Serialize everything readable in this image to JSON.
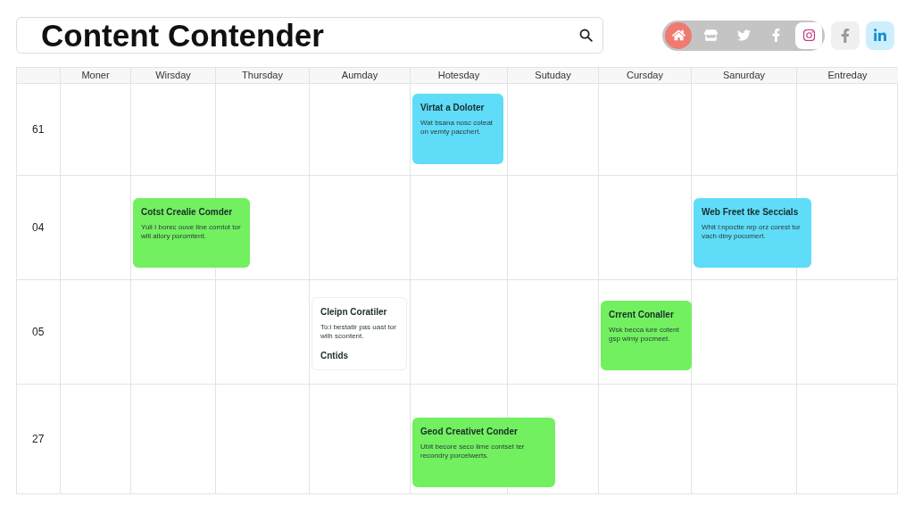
{
  "header": {
    "title": "Content Contender"
  },
  "social_group": [
    {
      "kind": "home",
      "selected": true
    },
    {
      "kind": "shop",
      "selected": false
    },
    {
      "kind": "twitter",
      "selected": false
    },
    {
      "kind": "facebook",
      "selected": false
    },
    {
      "kind": "instagram",
      "selected": false
    }
  ],
  "social_buttons": [
    {
      "kind": "facebook"
    },
    {
      "kind": "linkedin"
    }
  ],
  "calendar": {
    "columns": [
      "Moner",
      "Wirsday",
      "Thursday",
      "Aumday",
      "Hotesday",
      "Sutuday",
      "Cursday",
      "Sanurday",
      "Entreday"
    ],
    "rows": [
      {
        "label": "61",
        "events": [
          {
            "title": "Virtat a Doloter",
            "text": "Wat bsana nosc coteat on vemty pacchert.",
            "color": "#5fdcf8"
          }
        ]
      },
      {
        "label": "04",
        "events": [
          {
            "title": "Cotst Crealie Comder",
            "text": "Yuil I borec ouve line comtot tor will allory poromtent.",
            "color": "#72f060"
          },
          {
            "title": "Web Freet tke Seccials",
            "text": "Whit l:npoctie nrp orz corest tur vach diny pocomert.",
            "color": "#5fdcf8"
          }
        ]
      },
      {
        "label": "05",
        "events": [
          {
            "title": "Cleipn Coratiler",
            "text": "To:i bestatir pas uast tor wilh scontent.",
            "extra": "Cntids",
            "color": "#ffffff"
          },
          {
            "title": "Crrent Conaller",
            "text": "Wsk becca iure cotent gsp wimy pocmeet.",
            "color": "#72f060"
          }
        ]
      },
      {
        "label": "27",
        "events": [
          {
            "title": "Geod Creativet Conder",
            "text": "Ubit becore seco lime contset ter recondry porcelwerts.",
            "color": "#72f060"
          }
        ]
      }
    ]
  }
}
